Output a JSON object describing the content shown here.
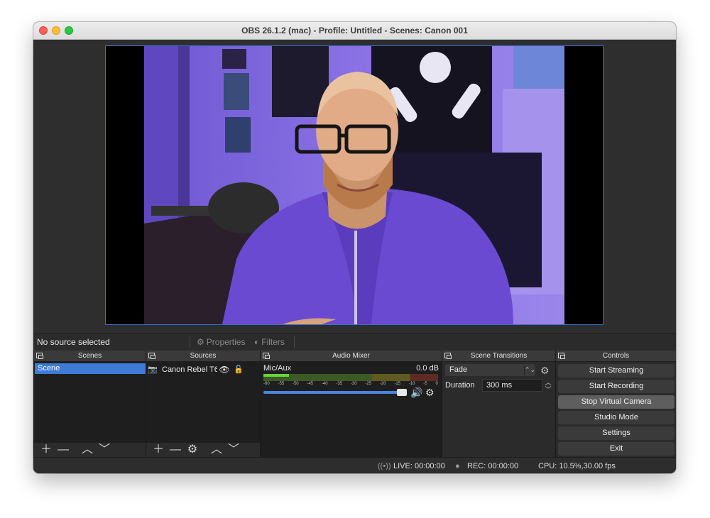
{
  "window": {
    "title": "OBS 26.1.2 (mac) - Profile: Untitled - Scenes: Canon 001"
  },
  "source_bar": {
    "status": "No source selected",
    "properties": "Properties",
    "filters": "Filters"
  },
  "docks": {
    "scenes": {
      "title": "Scenes",
      "items": [
        "Scene"
      ]
    },
    "sources": {
      "title": "Sources",
      "items": [
        {
          "name": "Canon Rebel T6",
          "visible": true,
          "locked": false
        }
      ]
    },
    "mixer": {
      "title": "Audio Mixer",
      "tracks": [
        {
          "name": "Mic/Aux",
          "db": "0.0 dB",
          "volume_fraction": 1.0
        }
      ],
      "ticks": [
        "-60",
        "-55",
        "-50",
        "-45",
        "-40",
        "-35",
        "-30",
        "-25",
        "-20",
        "-15",
        "-10",
        "-5",
        "0"
      ]
    },
    "transitions": {
      "title": "Scene Transitions",
      "selected": "Fade",
      "duration_label": "Duration",
      "duration_value": "300 ms"
    },
    "controls": {
      "title": "Controls",
      "buttons": [
        "Start Streaming",
        "Start Recording",
        "Stop Virtual Camera",
        "Studio Mode",
        "Settings",
        "Exit"
      ],
      "active": "Stop Virtual Camera"
    }
  },
  "status": {
    "live": "LIVE: 00:00:00",
    "rec": "REC: 00:00:00",
    "cpu": "CPU: 10.5%,30.00 fps"
  },
  "colors": {
    "accent": "#3d7bd6",
    "window_bg": "#2d2d2d",
    "preview_border": "#3b6ccf"
  }
}
